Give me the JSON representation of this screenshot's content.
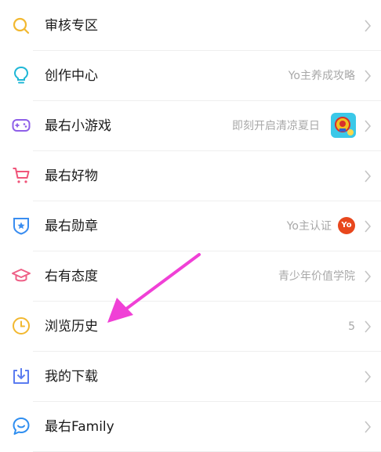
{
  "menu": {
    "items": [
      {
        "label": "审核专区",
        "right_text": "",
        "icon": "search-magnifier-icon"
      },
      {
        "label": "创作中心",
        "right_text": "Yo主养成攻略",
        "icon": "lightbulb-icon"
      },
      {
        "label": "最右小游戏",
        "right_text": "即刻开启清凉夏日",
        "icon": "gamepad-icon"
      },
      {
        "label": "最右好物",
        "right_text": "",
        "icon": "shopping-cart-icon"
      },
      {
        "label": "最右勋章",
        "right_text": "Yo主认证",
        "badge_text": "Yo",
        "icon": "shield-star-icon"
      },
      {
        "label": "右有态度",
        "right_text": "青少年价值学院",
        "icon": "graduation-cap-icon"
      },
      {
        "label": "浏览历史",
        "right_text": "5",
        "icon": "clock-icon"
      },
      {
        "label": "我的下载",
        "right_text": "",
        "icon": "download-icon"
      },
      {
        "label": "最右Family",
        "right_text": "",
        "icon": "chat-bubble-icon"
      }
    ]
  },
  "colors": {
    "search": "#f2b830",
    "lightbulb": "#1fb7d6",
    "gamepad": "#8e5fe8",
    "cart": "#f0557a",
    "shield": "#3a8df0",
    "cap": "#ee5f86",
    "clock": "#f2b830",
    "download": "#5b7cf0",
    "family": "#2f8ef0",
    "annotation_arrow": "#f040d6",
    "yo_badge": "#e8471d"
  }
}
